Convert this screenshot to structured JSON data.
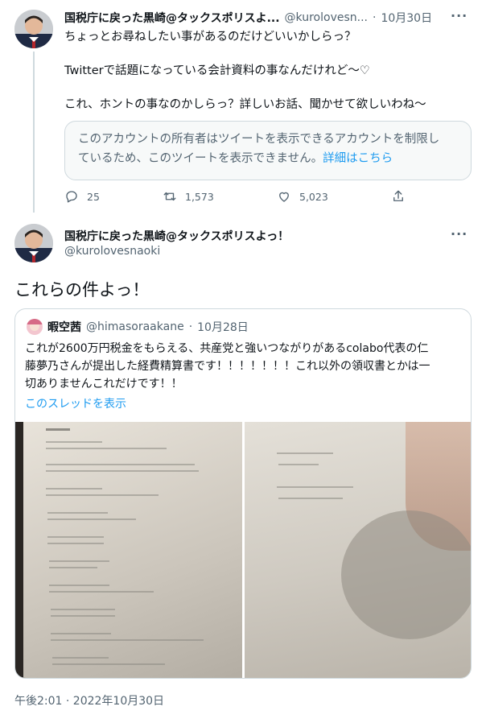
{
  "reply_tweet": {
    "display_name": "国税庁に戻った黒崎@タックスポリスよ...",
    "handle": "@kurolovesn...",
    "separator": "·",
    "date": "10月30日",
    "more_label": "···",
    "lines": [
      "ちょっとお尋ねしたい事があるのだけどいいかしらっ？",
      "Twitterで話題になっている会計資料の事なんだけれど〜♡",
      "これ、ホントの事なのかしらっ？詳しいお話、聞かせて欲しいわね〜"
    ],
    "notice_line1": "このアカウントの所有者はツイートを表示できるアカウントを制限し",
    "notice_line2": "ているため、このツイートを表示できません。",
    "notice_link": "詳細はこちら",
    "reply_count": "25",
    "retweet_count": "1,573",
    "like_count": "5,023"
  },
  "main_tweet": {
    "display_name": "国税庁に戻った黒崎@タックスポリスよっ！",
    "handle": "@kurolovesnaoki",
    "more_label": "···",
    "text": "これらの件よっ！",
    "timestamp": "午後2:01 · 2022年10月30日"
  },
  "quoted_tweet": {
    "display_name": "暇空茜",
    "handle": "@himasoraakane",
    "separator": "·",
    "date": "10月28日",
    "lines": [
      "これが2600万円税金をもらえる、共産党と強いつながりがあるcolabo代表の仁",
      "藤夢乃さんが提出した経費精算書です！！！！！！！これ以外の領収書とかは一",
      "切ありませんこれだけです！！"
    ],
    "show_thread": "このスレッドを表示"
  },
  "colors": {
    "accent": "#1d9bf0",
    "text": "#0f1419",
    "secondary": "#536471",
    "border": "#cfd9de"
  },
  "icons": [
    "reply-icon",
    "retweet-icon",
    "like-icon",
    "share-icon",
    "more-icon"
  ]
}
